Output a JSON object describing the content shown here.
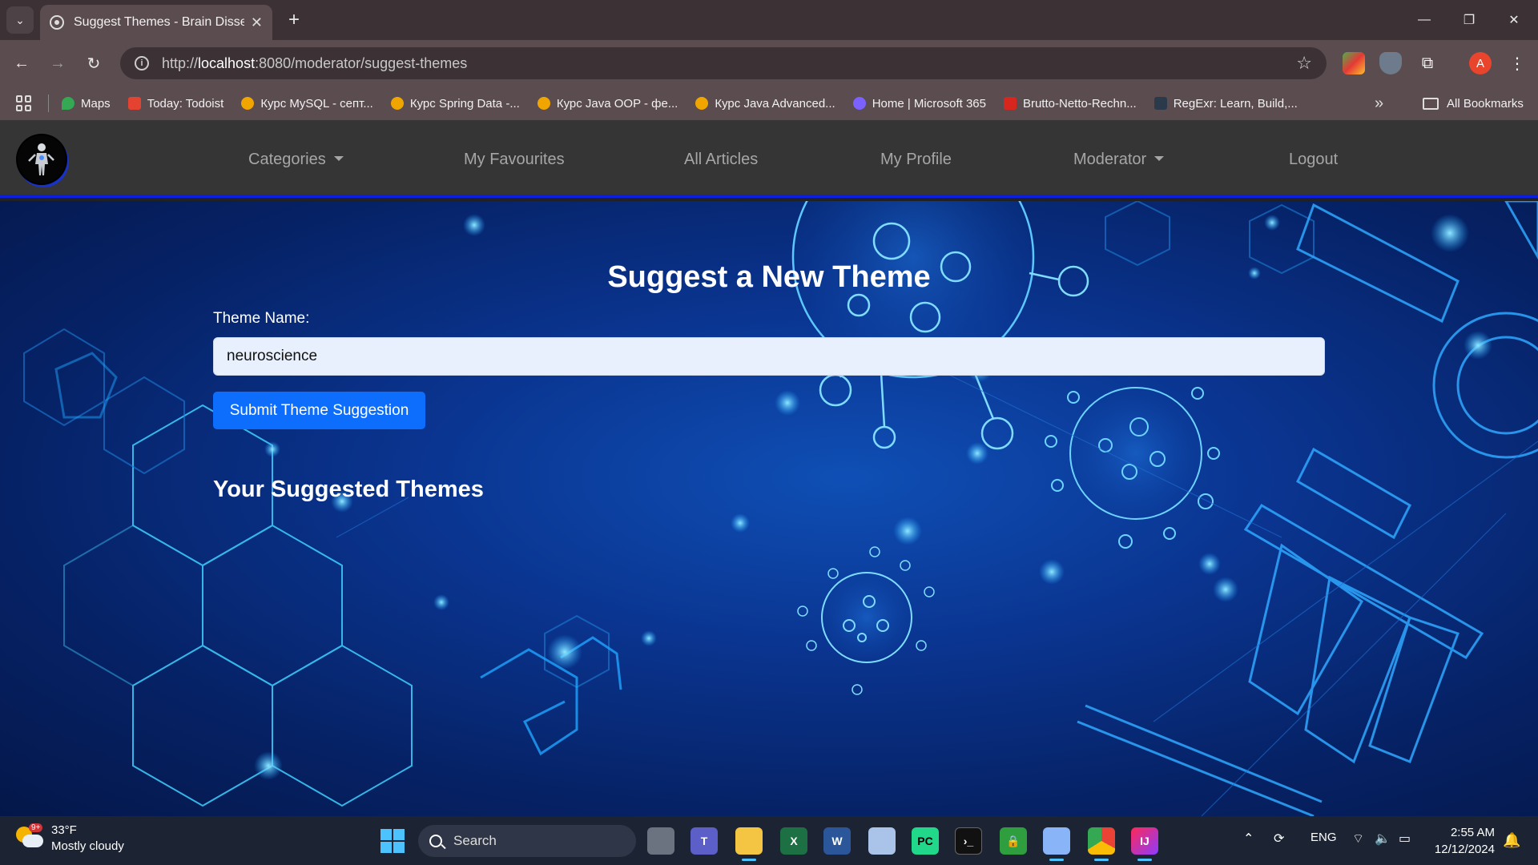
{
  "browser": {
    "tab_title": "Suggest Themes - Brain Dissect",
    "url_scheme": "http://",
    "url_host": "localhost",
    "url_rest": ":8080/moderator/suggest-themes",
    "bookmarks": [
      {
        "label": "Maps",
        "color": "#34a853"
      },
      {
        "label": "Today: Todoist",
        "color": "#e44332"
      },
      {
        "label": "Курс MySQL - септ...",
        "color": "#f0a500"
      },
      {
        "label": "Курс Spring Data -...",
        "color": "#f0a500"
      },
      {
        "label": "Курс Java OOP - фе...",
        "color": "#f0a500"
      },
      {
        "label": "Курс Java Advanced...",
        "color": "#f0a500"
      },
      {
        "label": "Home | Microsoft 365",
        "color": "#7b61ff"
      },
      {
        "label": "Brutto-Netto-Rechn...",
        "color": "#d7261e"
      },
      {
        "label": "RegExr: Learn, Build,...",
        "color": "#2b3a4a"
      }
    ],
    "all_bookmarks": "All Bookmarks",
    "profile_initial": "A"
  },
  "nav": {
    "categories": "Categories",
    "favourites": "My Favourites",
    "articles": "All Articles",
    "profile": "My Profile",
    "moderator": "Moderator",
    "logout": "Logout"
  },
  "form": {
    "title": "Suggest a New Theme",
    "label": "Theme Name:",
    "value": "neuroscience",
    "submit": "Submit Theme Suggestion",
    "section_title": "Your Suggested Themes"
  },
  "taskbar": {
    "temp": "33°F",
    "weather": "Mostly cloudy",
    "weather_badge": "9+",
    "search": "Search",
    "lang": "ENG",
    "time": "2:55 AM",
    "date": "12/12/2024"
  },
  "colors": {
    "accent": "#0d6efd",
    "navbar_border": "#0c1ee0",
    "navbar_bg": "#353536"
  }
}
